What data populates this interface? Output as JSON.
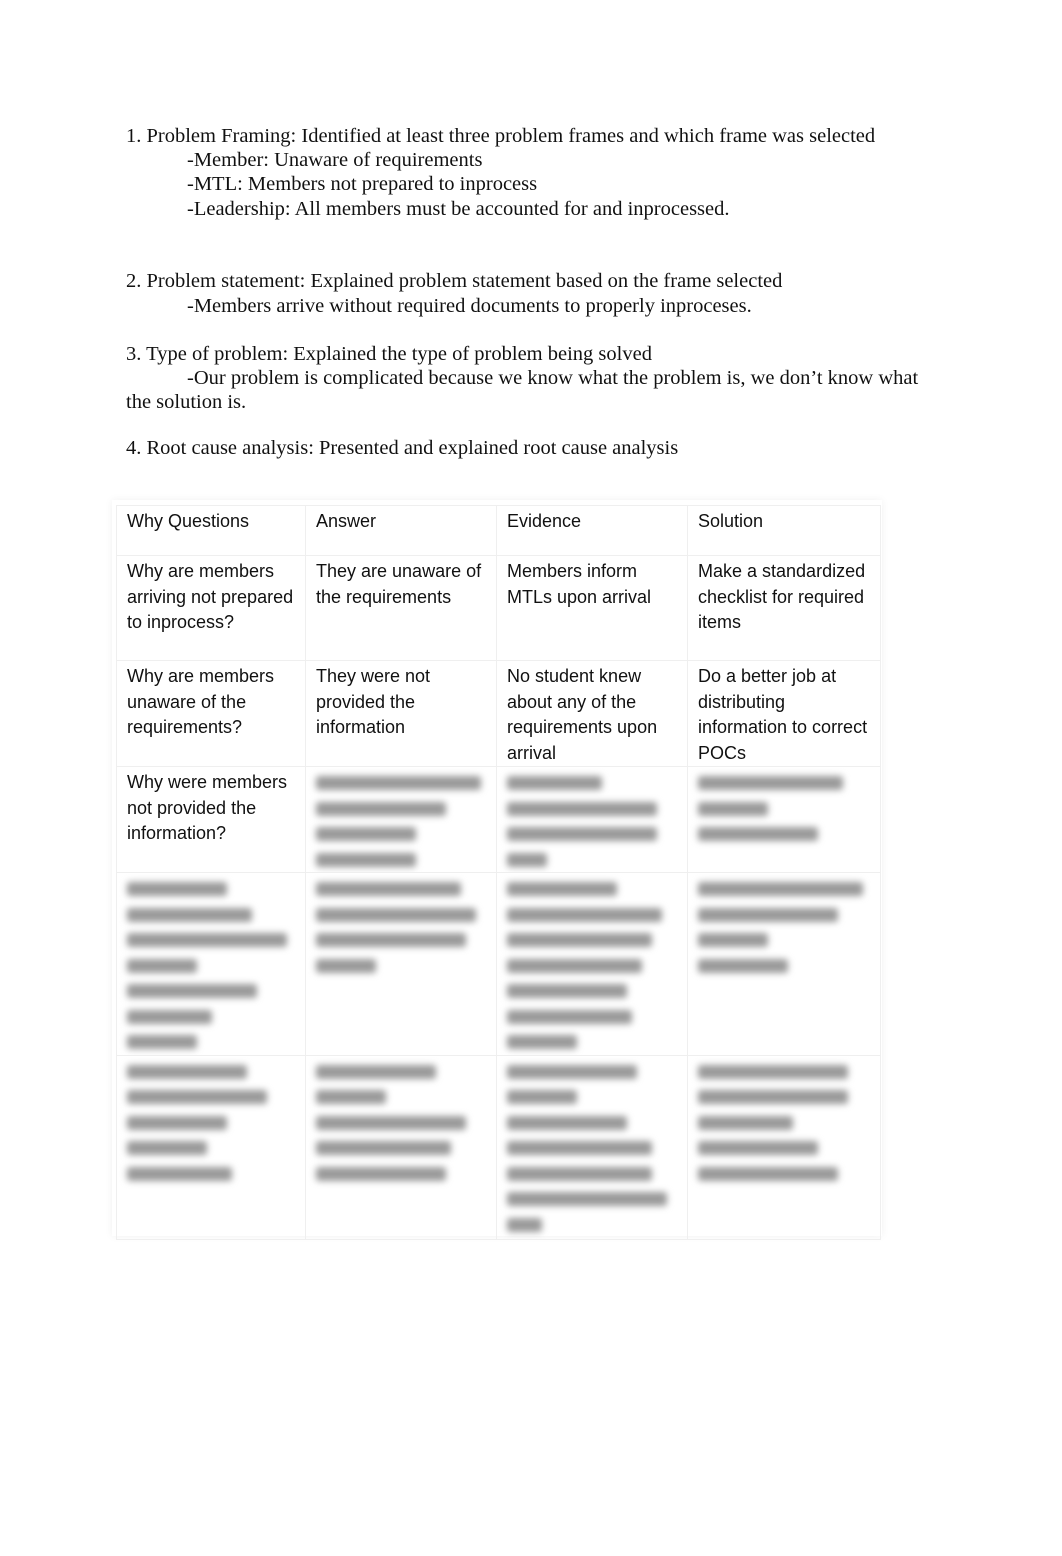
{
  "sections": [
    {
      "heading": "1. Problem Framing: Identified at least three problem frames and which frame was selected",
      "bullets": [
        "-Member: Unaware of requirements",
        "-MTL: Members not prepared to inprocess",
        "-Leadership: All members must be accounted for and inprocessed."
      ]
    },
    {
      "heading": "2. Problem statement: Explained problem statement based on the frame selected",
      "bullets": [
        "-Members arrive without required documents to properly inproceses."
      ]
    },
    {
      "heading": "3. Type of problem: Explained the type of problem being solved",
      "bullets": [
        "-Our problem is complicated because we know what the problem is, we don’t know what",
        "the solution is."
      ]
    },
    {
      "heading": "4. Root cause analysis: Presented and explained root cause analysis",
      "bullets": []
    }
  ],
  "table": {
    "headers": [
      "Why Questions",
      "Answer",
      "Evidence",
      "Solution"
    ],
    "rows": [
      {
        "why": "Why are members arriving not prepared to inprocess?",
        "answer": "They are unaware of the requirements",
        "evidence": "Members inform MTLs upon arrival",
        "solution": "Make a standardized checklist for required items"
      },
      {
        "why": "Why are members unaware of the requirements?",
        "answer": "They were not provided the information",
        "evidence": "No student knew about any of the requirements upon arrival",
        "solution": "Do a better job at distributing information to correct POCs"
      },
      {
        "why": "Why were members not provided the information?",
        "answer": "[blurred]",
        "evidence": "[blurred]",
        "solution": "[blurred]"
      },
      {
        "why": "[blurred]",
        "answer": "[blurred]",
        "evidence": "[blurred]",
        "solution": "[blurred]"
      },
      {
        "why": "[blurred]",
        "answer": "[blurred]",
        "evidence": "[blurred]",
        "solution": "[blurred]"
      }
    ]
  }
}
